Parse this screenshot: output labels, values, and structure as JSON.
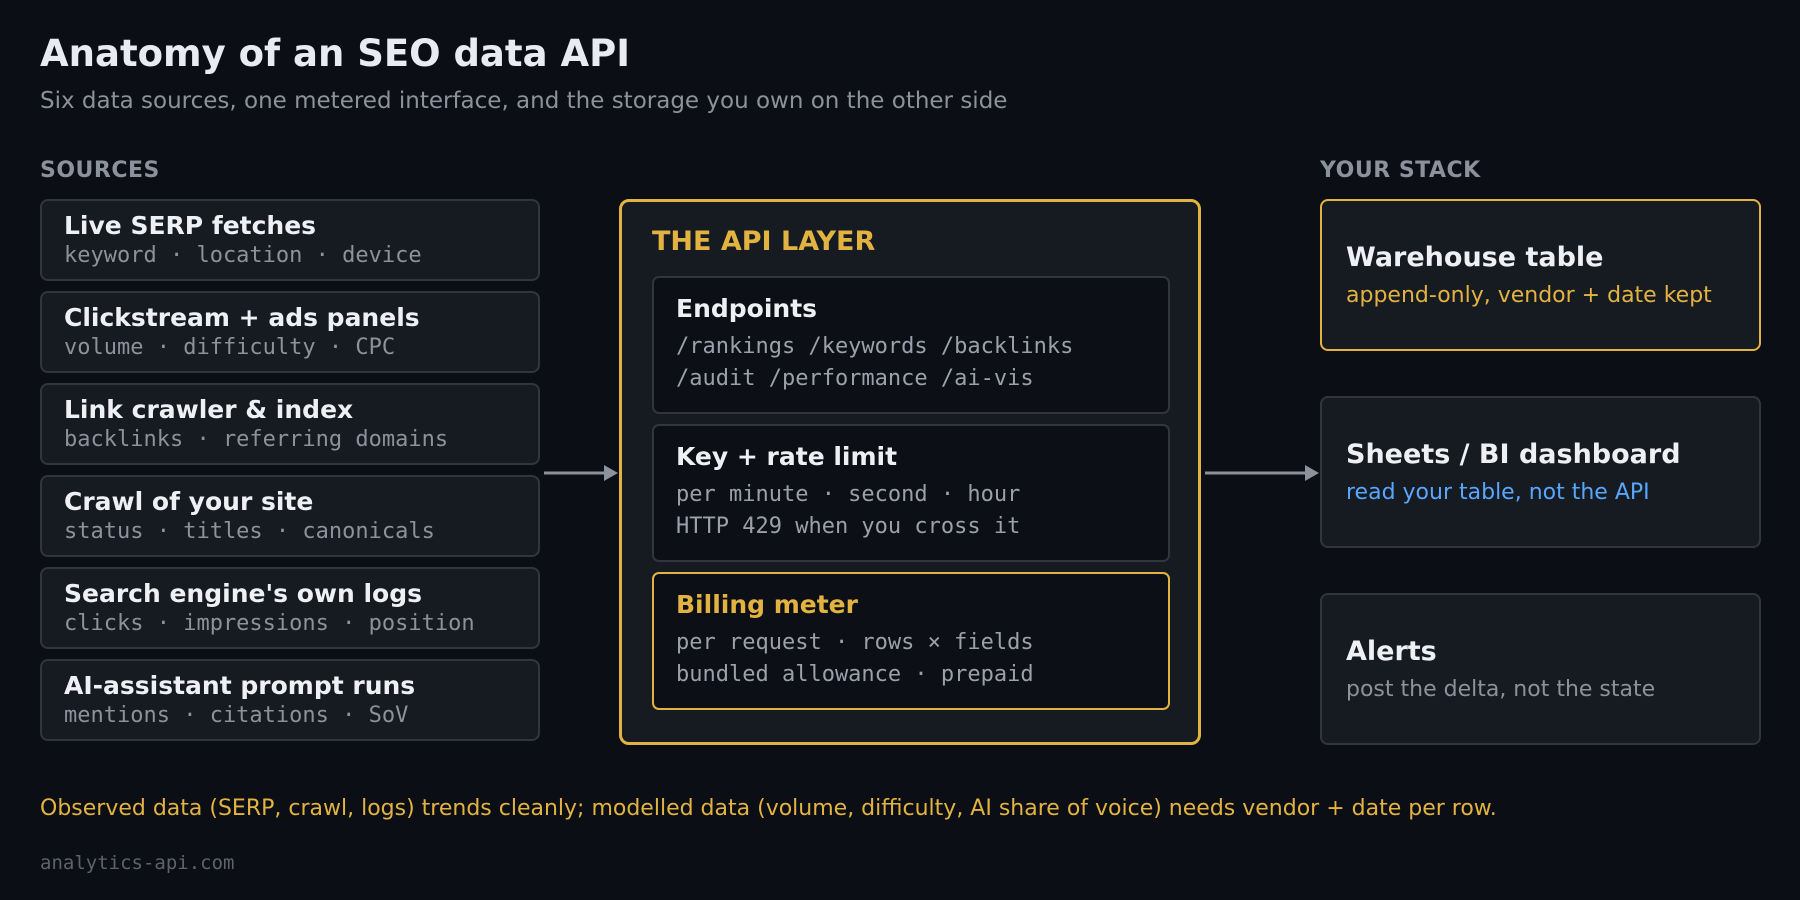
{
  "header": {
    "title": "Anatomy of an SEO data API",
    "subtitle": "Six data sources, one metered interface, and the storage you own on the other side"
  },
  "sources": {
    "label": "SOURCES",
    "items": [
      {
        "title": "Live SERP fetches",
        "detail": "keyword · location · device"
      },
      {
        "title": "Clickstream + ads panels",
        "detail": "volume · difficulty · CPC"
      },
      {
        "title": "Link crawler & index",
        "detail": "backlinks · referring domains"
      },
      {
        "title": "Crawl of your site",
        "detail": "status · titles · canonicals"
      },
      {
        "title": "Search engine's own logs",
        "detail": "clicks · impressions · position"
      },
      {
        "title": "AI-assistant prompt runs",
        "detail": "mentions · citations · SoV"
      }
    ]
  },
  "api_layer": {
    "label": "THE API LAYER",
    "endpoints": {
      "title": "Endpoints",
      "lines": [
        "/rankings /keywords /backlinks",
        "/audit /performance /ai-vis"
      ]
    },
    "rate_limit": {
      "title": "Key + rate limit",
      "lines": [
        "per minute · second · hour",
        "HTTP 429 when you cross it"
      ]
    },
    "billing": {
      "title": "Billing meter",
      "lines": [
        "per request · rows × fields",
        "bundled allowance · prepaid"
      ]
    }
  },
  "stack": {
    "label": "YOUR STACK",
    "items": [
      {
        "title": "Warehouse table",
        "detail": "append-only, vendor + date kept"
      },
      {
        "title": "Sheets / BI dashboard",
        "detail": "read your table, not the API"
      },
      {
        "title": "Alerts",
        "detail": "post the delta, not the state"
      }
    ]
  },
  "footnote": "Observed data (SERP, crawl, logs) trends cleanly; modelled data (volume, difficulty, AI share of voice) needs vendor + date per row.",
  "credit": "analytics-api.com",
  "colors": {
    "background": "#0b0e14",
    "accent": "#e3b341",
    "link_blue": "#58a6ff",
    "muted": "#8b929c",
    "arrow": "#8b929c"
  }
}
